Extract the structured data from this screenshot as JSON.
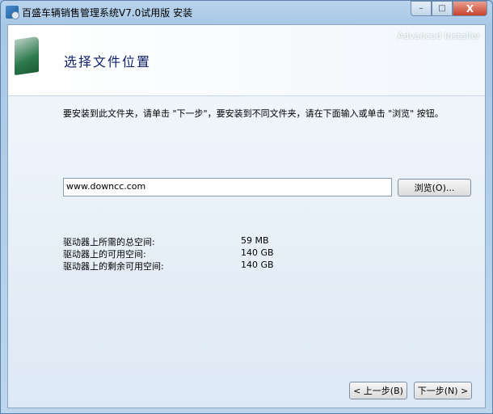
{
  "window": {
    "title": "百盛车辆销售管理系统V7.0试用版 安装",
    "min": "–",
    "max": "□",
    "close": "X"
  },
  "header": {
    "brand": "Advanced Installer",
    "title": "选择文件位置"
  },
  "instruction": "要安装到此文件夹，请单击 \"下一步\"，要安装到不同文件夹，请在下面输入或单击 \"浏览\" 按钮。",
  "path_value": "www.downcc.com",
  "browse_label": "浏览(O)...",
  "space": [
    {
      "label": "驱动器上所需的总空间:",
      "value": "59 MB"
    },
    {
      "label": "驱动器上的可用空间:",
      "value": "140 GB"
    },
    {
      "label": "驱动器上的剩余可用空间:",
      "value": "140 GB"
    }
  ],
  "buttons": {
    "back": "< 上一步(B)",
    "next": "下一步(N) >"
  }
}
